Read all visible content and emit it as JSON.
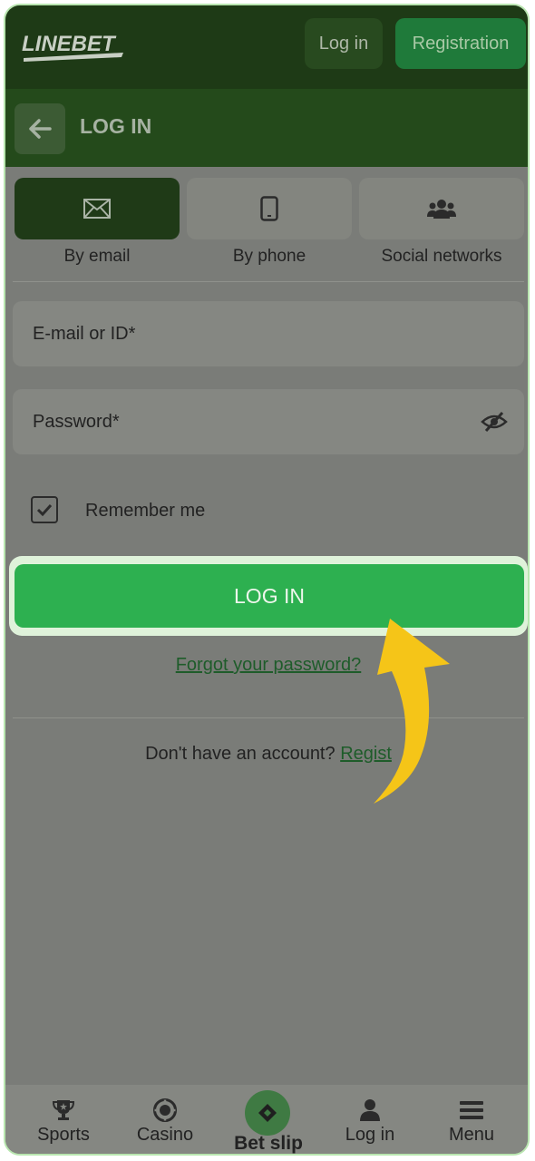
{
  "header": {
    "brand": "LINEBET",
    "login_label": "Log in",
    "register_label": "Registration"
  },
  "subheader": {
    "title": "LOG IN"
  },
  "methods": [
    {
      "label": "By email",
      "icon": "envelope-icon",
      "active": true
    },
    {
      "label": "By phone",
      "icon": "phone-icon",
      "active": false
    },
    {
      "label": "Social networks",
      "icon": "users-icon",
      "active": false
    }
  ],
  "form": {
    "email_placeholder": "E-mail or ID*",
    "password_placeholder": "Password*",
    "remember_label": "Remember me",
    "remember_checked": true,
    "submit_label": "LOG IN",
    "forgot_label": "Forgot your password?",
    "no_account_text": "Don't have an account?",
    "register_link": "Regist"
  },
  "bottom_nav": {
    "items": [
      {
        "label": "Sports",
        "icon": "trophy-icon"
      },
      {
        "label": "Casino",
        "icon": "chip-icon"
      },
      {
        "label": "Bet slip",
        "icon": "ticket-icon"
      },
      {
        "label": "Log in",
        "icon": "user-icon"
      },
      {
        "label": "Menu",
        "icon": "menu-icon"
      }
    ]
  },
  "colors": {
    "accent": "#2db050",
    "header": "#1e3a16",
    "highlight_arrow": "#f5c518"
  }
}
